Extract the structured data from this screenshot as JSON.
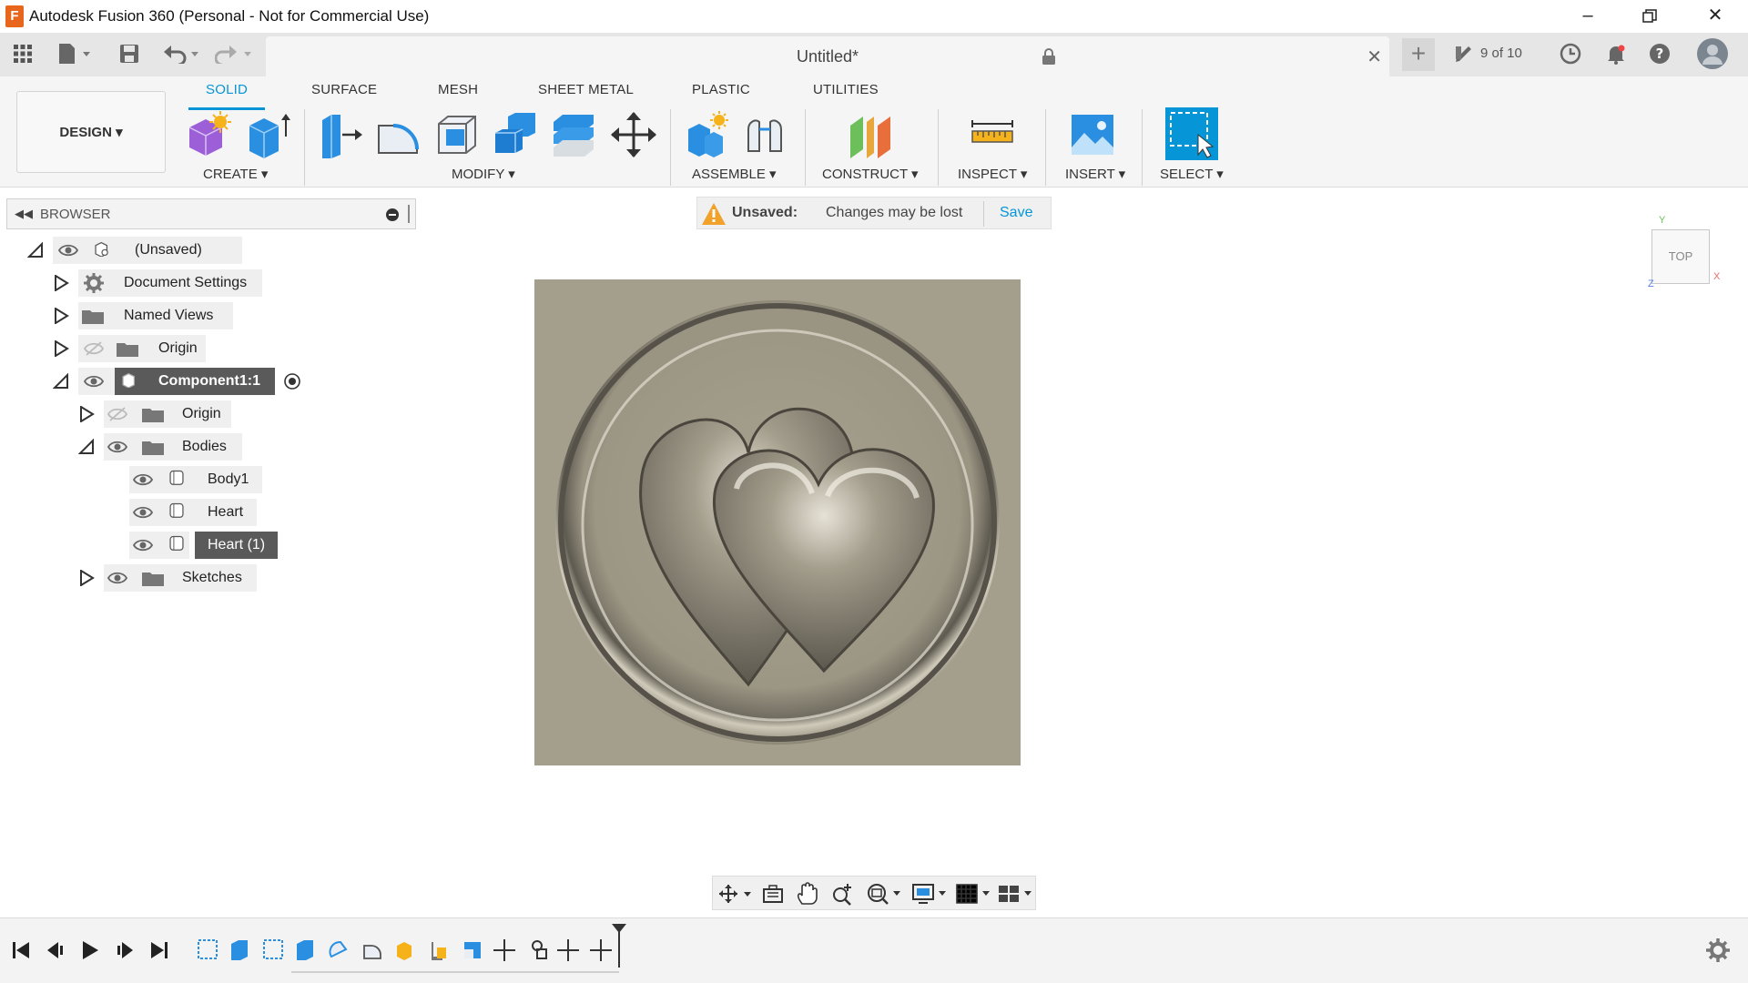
{
  "window": {
    "title": "Autodesk Fusion 360 (Personal - Not for Commercial Use)",
    "logo_letter": "F"
  },
  "document": {
    "title": "Untitled*",
    "version": "9 of 10"
  },
  "workspace": {
    "label": "DESIGN ▾"
  },
  "toolbar": {
    "tabs": [
      "SOLID",
      "SURFACE",
      "MESH",
      "SHEET METAL",
      "PLASTIC",
      "UTILITIES"
    ],
    "groups": {
      "create": "CREATE ▾",
      "modify": "MODIFY ▾",
      "assemble": "ASSEMBLE ▾",
      "construct": "CONSTRUCT ▾",
      "inspect": "INSPECT ▾",
      "insert": "INSERT ▾",
      "select": "SELECT ▾"
    }
  },
  "browser": {
    "title": "BROWSER",
    "items": [
      {
        "label": "(Unsaved)"
      },
      {
        "label": "Document Settings"
      },
      {
        "label": "Named Views"
      },
      {
        "label": "Origin"
      },
      {
        "label": "Component1:1"
      },
      {
        "label": "Origin"
      },
      {
        "label": "Bodies"
      },
      {
        "label": "Body1"
      },
      {
        "label": "Heart"
      },
      {
        "label": "Heart (1)"
      },
      {
        "label": "Sketches"
      }
    ]
  },
  "warning": {
    "label": "Unsaved:",
    "message": "Changes may be lost",
    "save": "Save"
  },
  "viewcube": {
    "face": "TOP",
    "axis_x": "X",
    "axis_y": "Y",
    "axis_z": "Z"
  },
  "colors": {
    "accent": "#0696d7",
    "selected_row": "#5a5a5a",
    "model_bg": "#a49e8c"
  }
}
